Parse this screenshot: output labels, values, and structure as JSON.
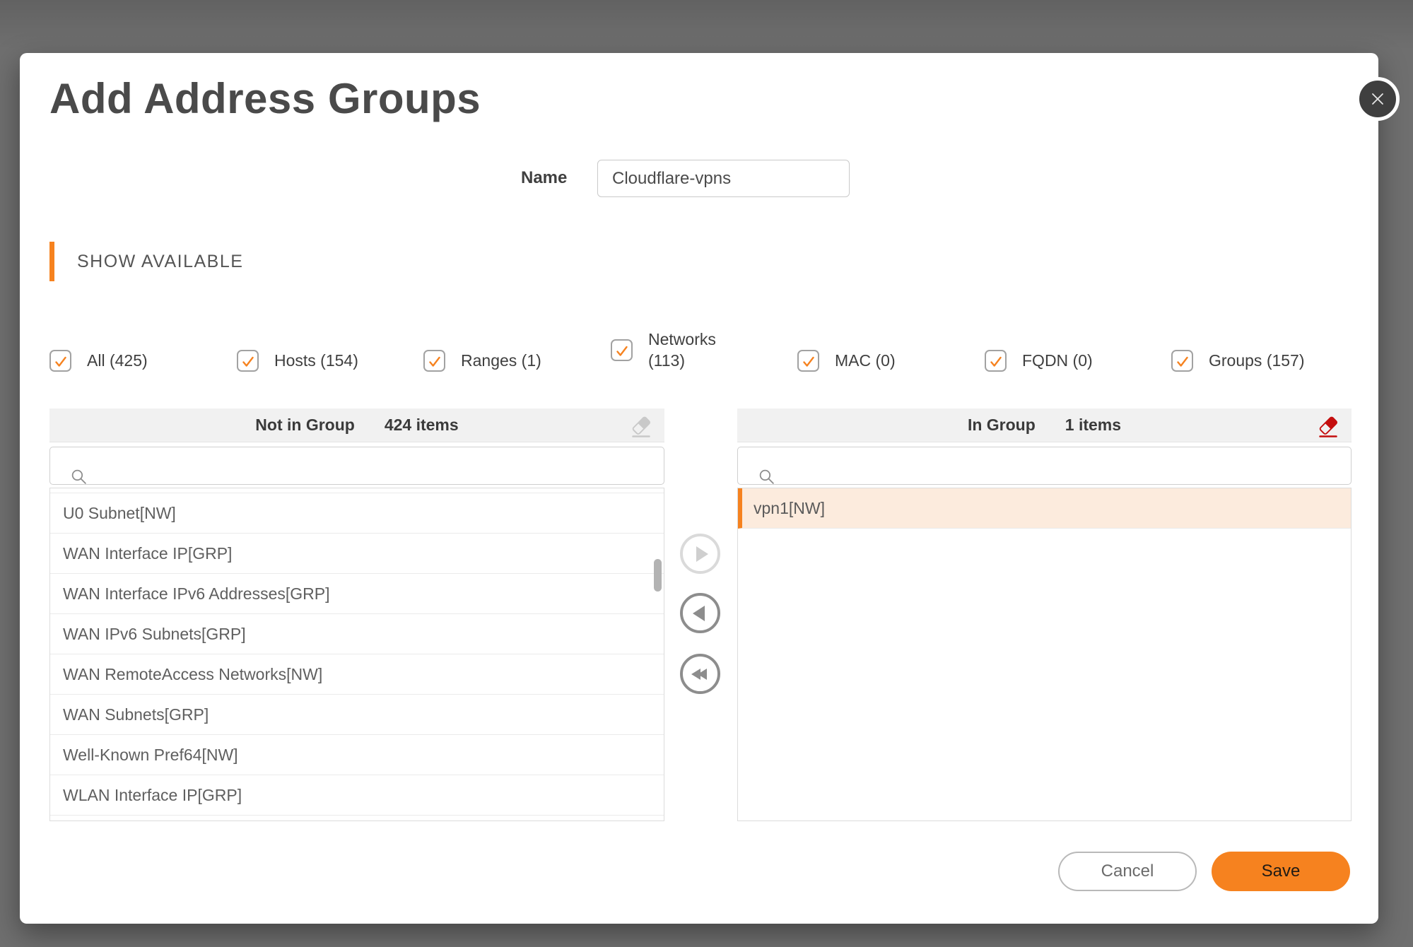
{
  "dialog": {
    "title": "Add Address Groups",
    "name_label": "Name",
    "name_value": "Cloudflare-vpns",
    "section_header": "SHOW AVAILABLE"
  },
  "filters": [
    {
      "label": "All (425)",
      "checked": true
    },
    {
      "label": "Hosts (154)",
      "checked": true
    },
    {
      "label": "Ranges (1)",
      "checked": true
    },
    {
      "label": "Networks (113)",
      "checked": true,
      "multiline": true
    },
    {
      "label": "MAC (0)",
      "checked": true
    },
    {
      "label": "FQDN (0)",
      "checked": true
    },
    {
      "label": "Groups (157)",
      "checked": true
    }
  ],
  "left_panel": {
    "title": "Not in Group",
    "count": "424 items",
    "search_value": "",
    "items": [
      "U0 Subnet[NW]",
      "WAN Interface IP[GRP]",
      "WAN Interface IPv6 Addresses[GRP]",
      "WAN IPv6 Subnets[GRP]",
      "WAN RemoteAccess Networks[NW]",
      "WAN Subnets[GRP]",
      "Well-Known Pref64[NW]",
      "WLAN Interface IP[GRP]"
    ]
  },
  "right_panel": {
    "title": "In Group",
    "count": "1 items",
    "search_value": "",
    "items": [
      "vpn1[NW]"
    ],
    "selected_index": 0
  },
  "transfer": {
    "move_right_enabled": false,
    "move_left_enabled": true,
    "move_all_left_enabled": true
  },
  "footer": {
    "cancel": "Cancel",
    "save": "Save"
  },
  "colors": {
    "accent": "#f6821f",
    "eraser_red": "#c40e0e",
    "eraser_gray": "#c9c9c9",
    "selected_row_bg": "#fcebdd",
    "backdrop": "#6e6e6e"
  }
}
